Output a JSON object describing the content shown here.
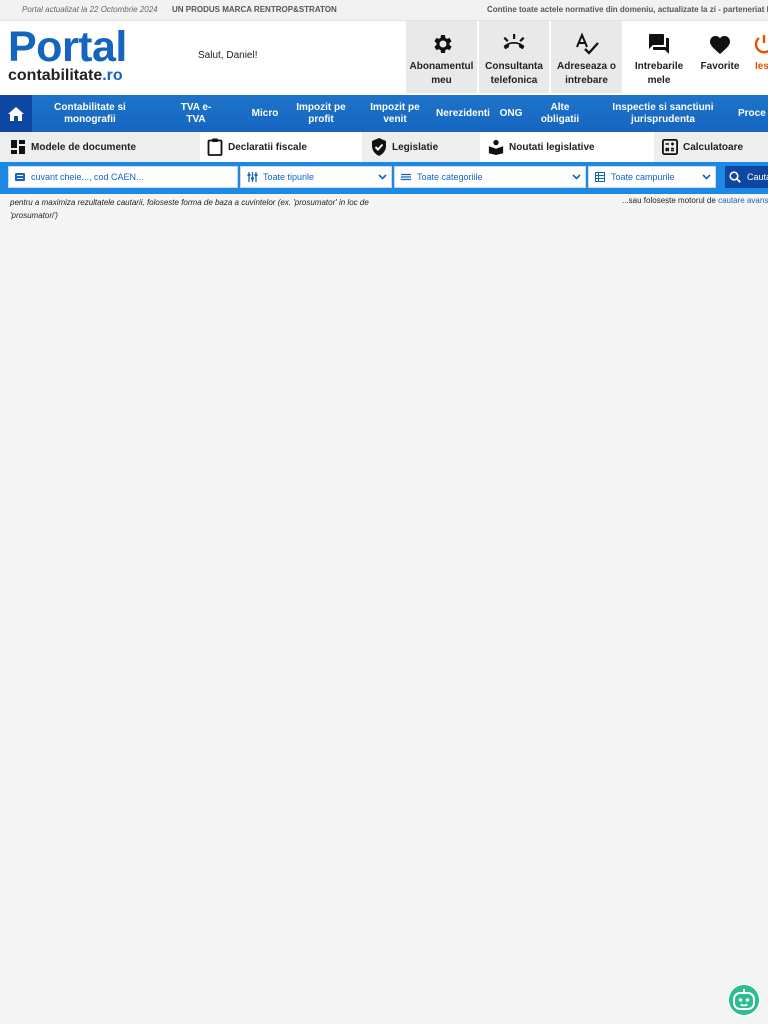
{
  "topbar": {
    "updated": "Portal actualizat la 22 Octombrie 2024",
    "brand": "UN PRODUS MARCA RENTROP&STRATON",
    "contains": "Contine toate actele normative din domeniu, actualizate la zi - parteneriat L"
  },
  "logo": {
    "line1": "Portal",
    "line2": "contabilitate",
    "suffix": ".ro"
  },
  "greeting": "Salut, Daniel!",
  "header_buttons": [
    {
      "label": "Abonamentul meu",
      "icon": "gear-icon"
    },
    {
      "label": "Consultanta telefonica",
      "icon": "phone-icon"
    },
    {
      "label": "Adreseaza o intrebare",
      "icon": "spellcheck-icon"
    },
    {
      "label": "Intrebarile mele",
      "icon": "forum-icon"
    },
    {
      "label": "Favorite",
      "icon": "heart-icon"
    },
    {
      "label": "Ies",
      "icon": "power-icon"
    }
  ],
  "nav": {
    "items": [
      "Contabilitate si monografii",
      "TVA e-TVA",
      "Micro",
      "Impozit pe profit",
      "Impozit pe venit",
      "Nerezidenti",
      "ONG",
      "Alte obligatii",
      "Inspectie si sanctiuni jurisprudenta",
      "Proce"
    ]
  },
  "tools": [
    {
      "label": "Modele de documente",
      "icon": "dashboard-icon"
    },
    {
      "label": "Declaratii fiscale",
      "icon": "clipboard-icon"
    },
    {
      "label": "Legislatie",
      "icon": "shield-check-icon"
    },
    {
      "label": "Noutati legislative",
      "icon": "book-reader-icon"
    },
    {
      "label": "Calculatoare",
      "icon": "calculator-icon"
    }
  ],
  "search": {
    "placeholder": "cuvant cheie..., cod CAEN...",
    "type_select": "Toate tipurile",
    "category_select": "Toate categoriile",
    "field_select": "Toate campurile",
    "button": "Cauta"
  },
  "hints": {
    "left": "pentru a maximiza rezultatele cautarii, foloseste forma de baza a cuvintelor (ex. 'prosumator' in loc de 'prosumatori')",
    "right_prefix": "...sau foloseste motorul de ",
    "right_link": "cautare avansa"
  },
  "colors": {
    "primary": "#1565c0",
    "nav_bg": "#1e74c9",
    "search_bg": "#1e88e5",
    "logout": "#e65100",
    "bot": "#2bbd8f"
  }
}
